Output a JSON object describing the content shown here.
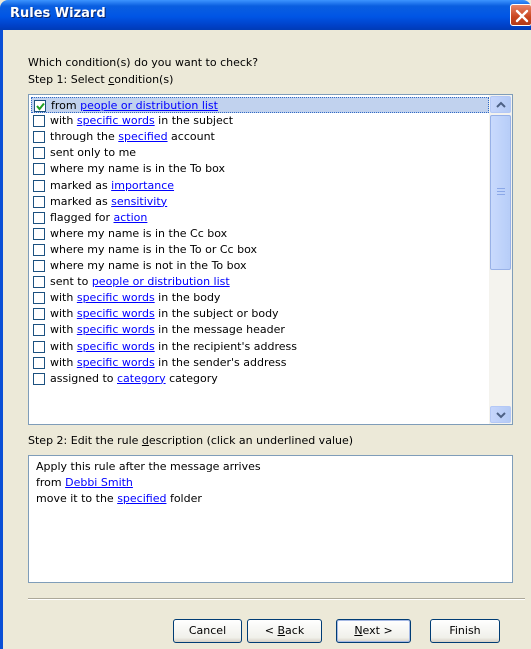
{
  "window": {
    "title": "Rules Wizard",
    "close_icon": "close-icon"
  },
  "question": "Which condition(s) do you want to check?",
  "step1": {
    "pre": "Step 1: Select ",
    "key": "c",
    "post": "ondition(s)"
  },
  "conditions": [
    {
      "checked": true,
      "parts": [
        {
          "t": "from "
        },
        {
          "t": "people or distribution list",
          "link": true
        }
      ]
    },
    {
      "checked": false,
      "parts": [
        {
          "t": "with "
        },
        {
          "t": "specific words",
          "link": true
        },
        {
          "t": " in the subject"
        }
      ]
    },
    {
      "checked": false,
      "parts": [
        {
          "t": "through the "
        },
        {
          "t": "specified",
          "link": true
        },
        {
          "t": " account"
        }
      ]
    },
    {
      "checked": false,
      "parts": [
        {
          "t": "sent only to me"
        }
      ]
    },
    {
      "checked": false,
      "parts": [
        {
          "t": "where my name is in the To box"
        }
      ]
    },
    {
      "checked": false,
      "parts": [
        {
          "t": "marked as "
        },
        {
          "t": "importance",
          "link": true
        }
      ]
    },
    {
      "checked": false,
      "parts": [
        {
          "t": "marked as "
        },
        {
          "t": "sensitivity",
          "link": true
        }
      ]
    },
    {
      "checked": false,
      "parts": [
        {
          "t": "flagged for "
        },
        {
          "t": "action",
          "link": true
        }
      ]
    },
    {
      "checked": false,
      "parts": [
        {
          "t": "where my name is in the Cc box"
        }
      ]
    },
    {
      "checked": false,
      "parts": [
        {
          "t": "where my name is in the To or Cc box"
        }
      ]
    },
    {
      "checked": false,
      "parts": [
        {
          "t": "where my name is not in the To box"
        }
      ]
    },
    {
      "checked": false,
      "parts": [
        {
          "t": "sent to "
        },
        {
          "t": "people or distribution list",
          "link": true
        }
      ]
    },
    {
      "checked": false,
      "parts": [
        {
          "t": "with "
        },
        {
          "t": "specific words",
          "link": true
        },
        {
          "t": " in the body"
        }
      ]
    },
    {
      "checked": false,
      "parts": [
        {
          "t": "with "
        },
        {
          "t": "specific words",
          "link": true
        },
        {
          "t": " in the subject or body"
        }
      ]
    },
    {
      "checked": false,
      "parts": [
        {
          "t": "with "
        },
        {
          "t": "specific words",
          "link": true
        },
        {
          "t": " in the message header"
        }
      ]
    },
    {
      "checked": false,
      "parts": [
        {
          "t": "with "
        },
        {
          "t": "specific words",
          "link": true
        },
        {
          "t": " in the recipient's address"
        }
      ]
    },
    {
      "checked": false,
      "parts": [
        {
          "t": "with "
        },
        {
          "t": "specific words",
          "link": true
        },
        {
          "t": " in the sender's address"
        }
      ]
    },
    {
      "checked": false,
      "parts": [
        {
          "t": "assigned to "
        },
        {
          "t": "category",
          "link": true
        },
        {
          "t": " category"
        }
      ]
    }
  ],
  "scrollbar": {
    "up_icon": "chevron-up-icon",
    "down_icon": "chevron-down-icon",
    "position": 0.0
  },
  "step2": {
    "pre": "Step 2: Edit the rule ",
    "key": "d",
    "post": "escription (click an underlined value)"
  },
  "description": [
    [
      {
        "t": "Apply this rule after the message arrives"
      }
    ],
    [
      {
        "t": "from "
      },
      {
        "t": "Debbi Smith",
        "link": true
      }
    ],
    [
      {
        "t": "move it to the "
      },
      {
        "t": "specified",
        "link": true
      },
      {
        "t": " folder"
      }
    ]
  ],
  "buttons": {
    "cancel": "Cancel",
    "back_pre": "< ",
    "back_key": "B",
    "back_post": "ack",
    "next_key": "N",
    "next_post": "ext >",
    "finish": "Finish"
  },
  "colors": {
    "link": "#0000ff",
    "selection": "#c1d2ee",
    "titlebar": "#0055e5"
  }
}
